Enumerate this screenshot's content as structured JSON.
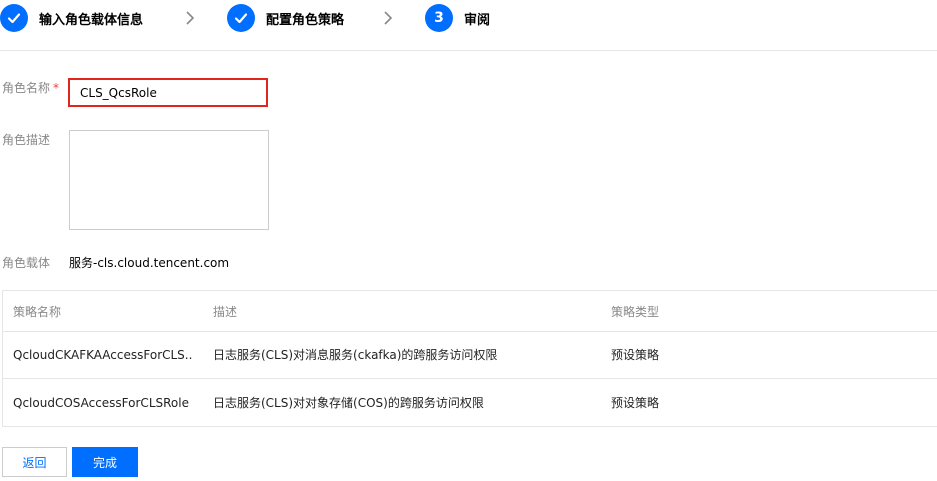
{
  "steps": [
    {
      "label": "输入角色载体信息",
      "state": "done",
      "icon": "check-icon"
    },
    {
      "label": "配置角色策略",
      "state": "done",
      "icon": "check-icon"
    },
    {
      "label": "审阅",
      "state": "current",
      "number": "3"
    }
  ],
  "form": {
    "name_label": "角色名称",
    "required_mark": "*",
    "name_value": "CLS_QcsRole",
    "desc_label": "角色描述",
    "desc_value": "",
    "carrier_label": "角色载体",
    "carrier_value": "服务-cls.cloud.tencent.com"
  },
  "table": {
    "headers": [
      "策略名称",
      "描述",
      "策略类型"
    ],
    "rows": [
      [
        "QcloudCKAFKAAccessForCLS...",
        "日志服务(CLS)对消息服务(ckafka)的跨服务访问权限",
        "预设策略"
      ],
      [
        "QcloudCOSAccessForCLSRole",
        "日志服务(CLS)对对象存储(COS)的跨服务访问权限",
        "预设策略"
      ]
    ]
  },
  "buttons": {
    "back": "返回",
    "finish": "完成"
  },
  "colors": {
    "primary": "#006eff",
    "highlight_border": "#e1251b"
  }
}
